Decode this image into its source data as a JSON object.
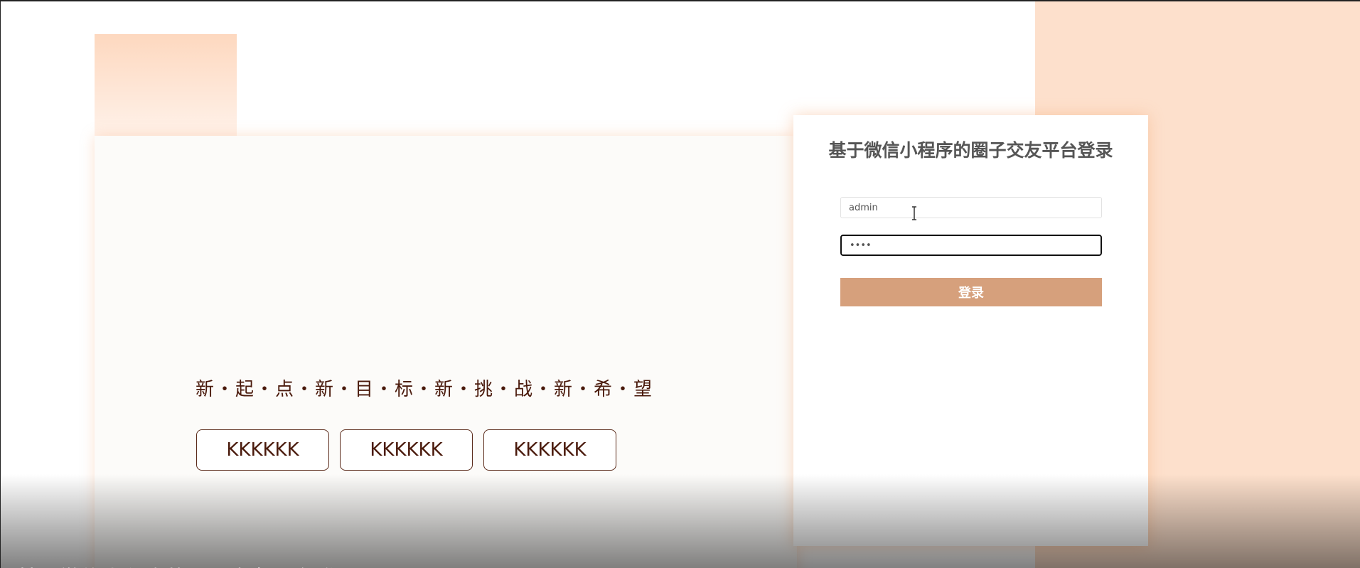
{
  "hero": {
    "slogan": "新・起・点・新・目・标・新・挑・战・新・希・望",
    "buttons": [
      {
        "label": "KKKKKK"
      },
      {
        "label": "KKKKKK"
      },
      {
        "label": "KKKKKK"
      }
    ]
  },
  "login": {
    "title": "基于微信小程序的圈子交友平台登录",
    "username_value": "admin",
    "password_value": "1234",
    "submit_label": "登录"
  },
  "footer": {
    "caption": "基于微信小程序的圈子交友平台登录"
  },
  "colors": {
    "peach_background": "#fde0cc",
    "login_button": "#d6a07c",
    "slogan_text": "#4a1a0c"
  },
  "icons": {
    "cursor": "text-cursor-icon"
  }
}
